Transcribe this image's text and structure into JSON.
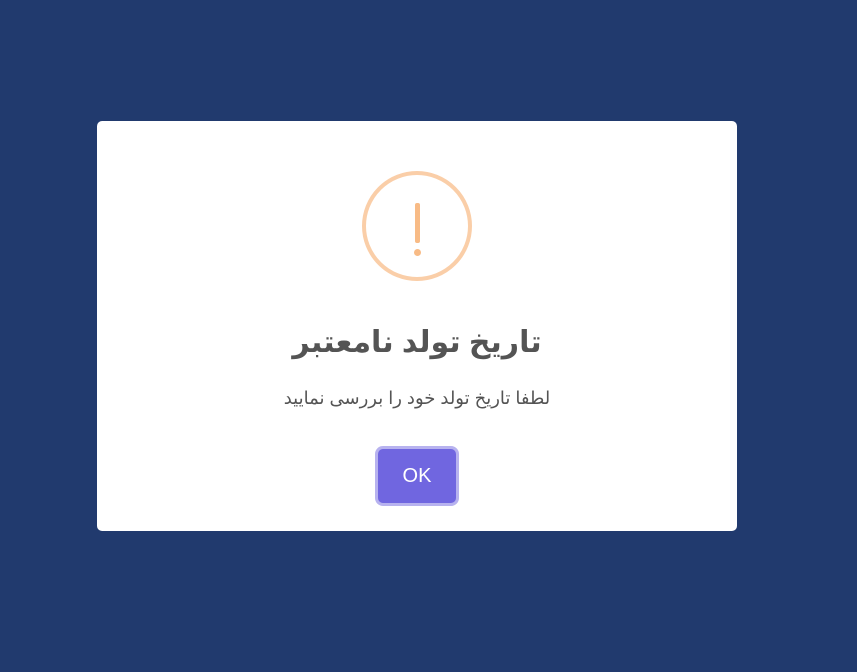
{
  "modal": {
    "icon": "warning-exclamation-icon",
    "icon_color": "#f8bb86",
    "icon_border_color": "#facea8",
    "title": "تاریخ تولد نامعتبر",
    "message": "لطفا تاریخ تولد خود را بررسی نمایید",
    "confirm_label": "OK",
    "confirm_color": "#7066e0"
  },
  "page": {
    "background_color": "#213a6e"
  }
}
